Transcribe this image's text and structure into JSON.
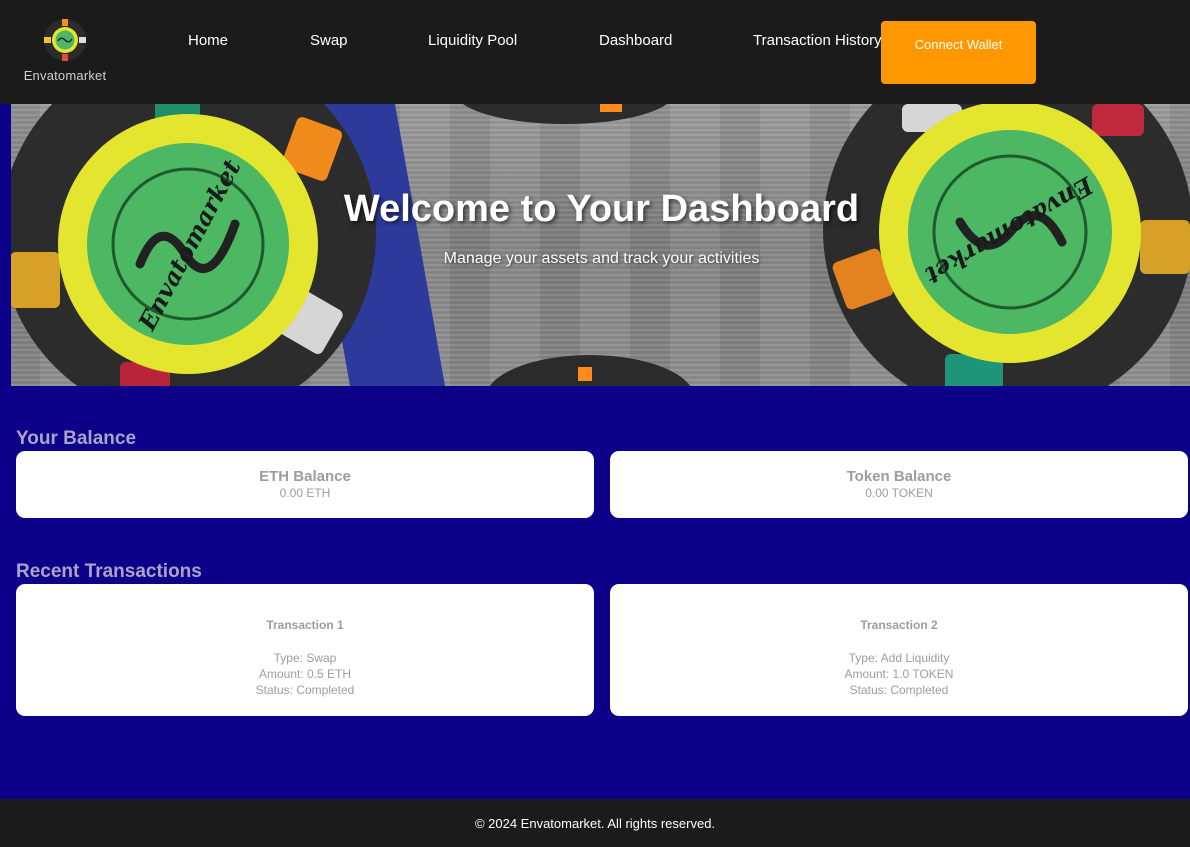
{
  "brand": {
    "name": "Envatomarket",
    "chip_colors": {
      "rim": "#e3e52e",
      "center": "#4cb863",
      "body": "#2b2b2b"
    }
  },
  "nav": {
    "items": [
      {
        "label": "Home"
      },
      {
        "label": "Swap"
      },
      {
        "label": "Liquidity Pool"
      },
      {
        "label": "Dashboard"
      },
      {
        "label": "Transaction History"
      }
    ],
    "connect_label": "Connect Wallet"
  },
  "hero": {
    "title": "Welcome to Your Dashboard",
    "subtitle": "Manage your assets and track your activities",
    "chip_text": "Envatomarket"
  },
  "balance": {
    "heading": "Your Balance",
    "cards": [
      {
        "title": "ETH Balance",
        "value": "0.00 ETH"
      },
      {
        "title": "Token Balance",
        "value": "0.00 TOKEN"
      }
    ]
  },
  "transactions": {
    "heading": "Recent Transactions",
    "items": [
      {
        "title": "Transaction 1",
        "type": "Type: Swap",
        "amount": "Amount: 0.5 ETH",
        "status": "Status: Completed"
      },
      {
        "title": "Transaction 2",
        "type": "Type: Add Liquidity",
        "amount": "Amount: 1.0 TOKEN",
        "status": "Status: Completed"
      }
    ]
  },
  "footer": {
    "text": "© 2024 Envatomarket. All rights reserved."
  },
  "colors": {
    "header_bg": "#1b1b1b",
    "page_bg": "#0d0089",
    "accent": "#ff9800",
    "section_title": "#a9a4c8",
    "card_text": "#9d9d9d"
  }
}
